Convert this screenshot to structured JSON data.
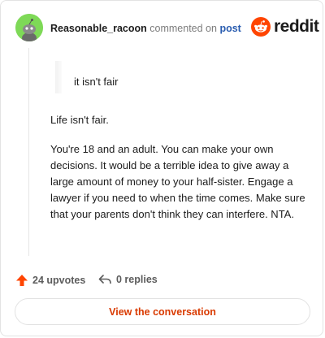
{
  "comment": {
    "username": "Reasonable_racoon",
    "action_text": "commented on",
    "post_link": "post",
    "quote": "it isn't fair",
    "paragraphs": [
      "Life isn't fair.",
      "You're 18 and an adult. You can make your own decisions. It would be a terrible idea to give away a large amount of money to your half-sister. Engage a lawyer if you need to when the time comes. Make sure that your parents don't think they can interfere. NTA."
    ]
  },
  "brand": {
    "name": "reddit",
    "accent_color": "#ff4500"
  },
  "footer": {
    "upvotes_label": "24 upvotes",
    "replies_label": "0 replies",
    "upvote_icon": "arrow-up-icon",
    "reply_icon": "reply-arrow-icon"
  },
  "cta": {
    "view_label": "View the conversation",
    "color": "#d93a00"
  },
  "avatar": {
    "icon": "snoo-avatar-icon",
    "background": "#7ed957"
  }
}
